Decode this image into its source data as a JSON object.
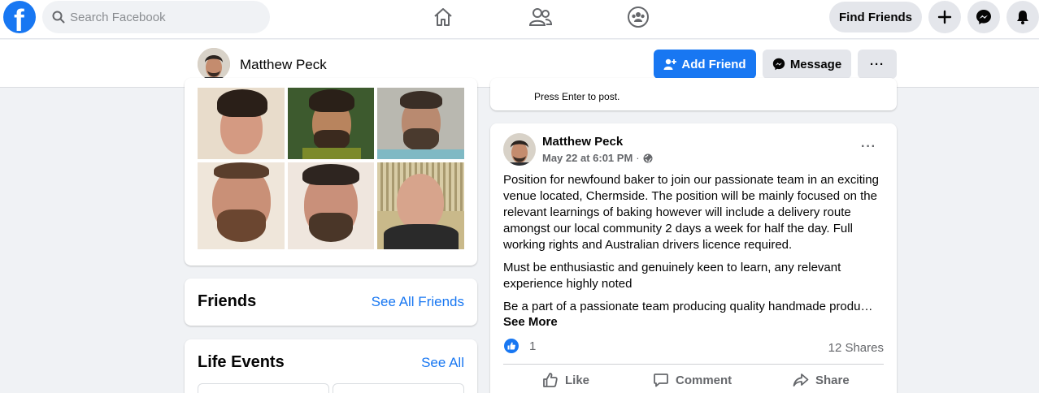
{
  "topbar": {
    "search_placeholder": "Search Facebook",
    "find_friends": "Find Friends",
    "icons": [
      "facebook-logo",
      "search-icon",
      "home-icon",
      "friends-icon",
      "groups-icon",
      "plus-icon",
      "messenger-icon",
      "notifications-icon"
    ]
  },
  "profile": {
    "name": "Matthew Peck",
    "add_friend": "Add Friend",
    "message": "Message",
    "more": "···"
  },
  "composer": {
    "hint": "Press Enter to post."
  },
  "friends_card": {
    "title": "Friends",
    "link": "See All Friends"
  },
  "life_events_card": {
    "title": "Life Events",
    "link": "See All"
  },
  "post": {
    "author": "Matthew Peck",
    "timestamp": "May 22 at 6:01 PM",
    "separator": "·",
    "privacy_icon": "globe-icon",
    "more": "···",
    "paragraphs": [
      "Position for newfound baker to join our passionate team in an exciting venue located, Chermside. The position will be mainly focused on the relevant learnings of baking however will include a delivery route amongst our local community 2 days a week for half the day. Full working rights and Australian drivers licence required.",
      "Must be enthusiastic and genuinely keen to learn, any relevant experience highly noted",
      "Be a part of a passionate team producing quality handmade produ…"
    ],
    "see_more": "See More",
    "like_count": "1",
    "shares": "12 Shares",
    "actions": {
      "like": "Like",
      "comment": "Comment",
      "share": "Share"
    }
  },
  "colors": {
    "accent": "#1877f2",
    "background": "#f0f2f5",
    "secondary_text": "#65676b"
  }
}
